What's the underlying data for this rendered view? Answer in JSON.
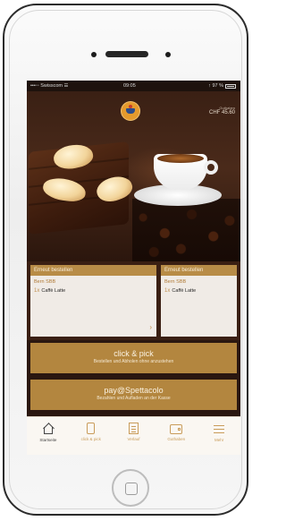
{
  "status_bar": {
    "carrier": "•••◦◦ Swisscom ☰",
    "time": "09:05",
    "battery": "↑ 97 %"
  },
  "header": {
    "credit_label": "Guthaben",
    "credit_amount": "CHF 45.60",
    "logo_icon": "coffee-cup-logo"
  },
  "cards": [
    {
      "header": "Erneut bestellen",
      "store": "Bern SBB",
      "product_bullet": "1x",
      "product": "Caffè Latte",
      "arrow": "›"
    },
    {
      "header": "Erneut bestellen",
      "store": "Bern SBB",
      "product_bullet": "1x",
      "product": "Caffè Latte"
    }
  ],
  "actions": {
    "click_pick_title": "click & pick",
    "click_pick_sub": "Bestellen und Abholen ohne anzustehen",
    "pay_title": "pay@Spettacolo",
    "pay_sub": "Bezahlen und Aufladen an der Kasse"
  },
  "tabs": [
    {
      "label": "Startseite",
      "icon": "home-icon",
      "active": true
    },
    {
      "label": "click & pick",
      "icon": "phone-icon",
      "active": false
    },
    {
      "label": "Verlauf",
      "icon": "document-icon",
      "active": false
    },
    {
      "label": "Guthaben",
      "icon": "wallet-icon",
      "active": false
    },
    {
      "label": "Mehr",
      "icon": "menu-icon",
      "active": false
    }
  ],
  "colors": {
    "accent": "#b3863f",
    "card_background": "#f0ebe6",
    "card_header": "#b88c47",
    "tab_active": "#444444",
    "tab_inactive": "#c99c5a"
  }
}
